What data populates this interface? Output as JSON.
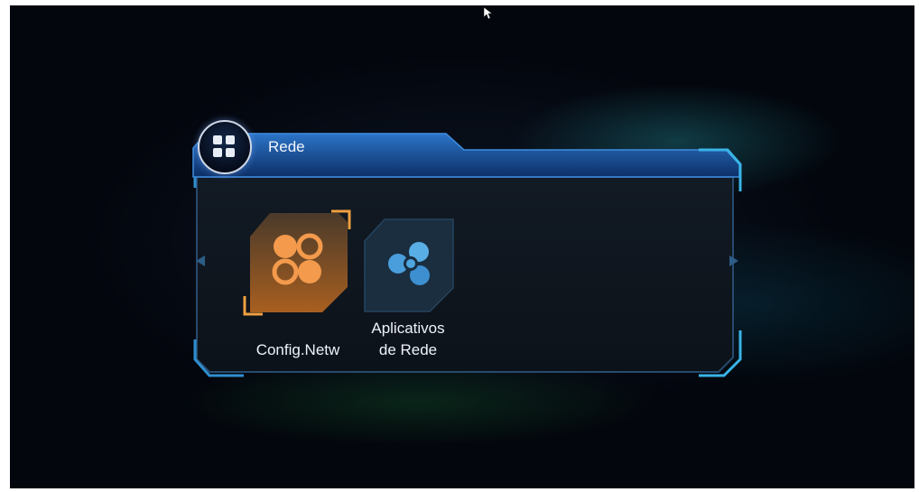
{
  "window": {
    "title": "Rede"
  },
  "nav": {
    "left_arrow_icon": "arrow-left-icon",
    "right_arrow_icon": "arrow-right-icon"
  },
  "header": {
    "icon": "apps-grid-icon"
  },
  "items": [
    {
      "label": "Config.Netw",
      "icon": "network-config-icon",
      "selected": true
    },
    {
      "label_line1": "Aplicativos",
      "label_line2": "de Rede",
      "icon": "network-apps-icon",
      "selected": false
    }
  ],
  "colors": {
    "accent": "#2aa9d8",
    "selected": "#f0a040",
    "frame": "#1f5fa8"
  }
}
